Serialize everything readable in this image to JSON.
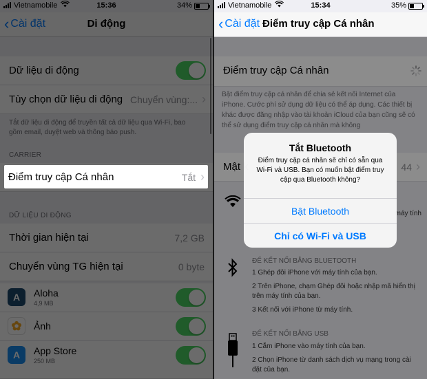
{
  "left": {
    "status": {
      "carrier": "Vietnamobile",
      "time": "15:36",
      "battery": "34%",
      "battery_level": 0.34
    },
    "nav": {
      "back": "Cài đặt",
      "title": "Di động"
    },
    "rows": {
      "mobile_data": "Dữ liệu di động",
      "data_options_label": "Tùy chọn dữ liệu di động",
      "data_options_value": "Chuyển vùng:..."
    },
    "footnote": "Tắt dữ liệu di động để truyền tất cả dữ liệu qua Wi-Fi, bao gồm email, duyệt web và thông báo push.",
    "carrier_header": "CARRIER",
    "hotspot": {
      "label": "Điểm truy cập Cá nhân",
      "value": "Tắt"
    },
    "usage_header": "DỮ LIỆU DI ĐỘNG",
    "current_period": {
      "label": "Thời gian hiện tại",
      "value": "7,2 GB"
    },
    "roaming": {
      "label": "Chuyển vùng TG hiện tại",
      "value": "0 byte"
    },
    "apps": [
      {
        "name": "Aloha",
        "size": "4,9 MB",
        "icon": "aloha-icon",
        "color": "#1e4b6e"
      },
      {
        "name": "Ảnh",
        "size": "",
        "icon": "photos-icon",
        "color": "#ffffff"
      },
      {
        "name": "App Store",
        "size": "250 MB",
        "icon": "app-store-icon",
        "color": "#1a8cf0"
      }
    ]
  },
  "right": {
    "status": {
      "carrier": "Vietnamobile",
      "time": "15:34",
      "battery": "35%",
      "battery_level": 0.35
    },
    "nav": {
      "back": "Cài đặt",
      "title": "Điểm truy cập Cá nhân"
    },
    "hotspot_label": "Điểm truy cập Cá nhân",
    "description": "Bật điểm truy cập cá nhân để chia sẻ kết nối Internet của iPhone. Cước phí sử dụng dữ liệu có thể áp dụng. Các thiết bị khác được đăng nhập vào tài khoản iCloud của bạn cũng sẽ có thể sử dụng điểm truy cập cá nhân mà không",
    "password_label": "Mật k",
    "password_value_partial": "44",
    "wifi_partial": "máy tính",
    "bluetooth_header": "ĐỂ KẾT NỐI BẰNG BLUETOOTH",
    "bluetooth_steps": [
      "1 Ghép đôi iPhone với máy tính của bạn.",
      "2 Trên iPhone, chạm Ghép đôi hoặc nhập mã hiển thị trên máy tính của bạn.",
      "3 Kết nối với iPhone từ máy tính."
    ],
    "usb_header": "ĐỂ KẾT NỐI BẰNG USB",
    "usb_steps": [
      "1 Cắm iPhone vào máy tính của bạn.",
      "2 Chọn iPhone từ danh sách dịch vụ mạng trong cài đặt của bạn."
    ],
    "alert": {
      "title": "Tắt Bluetooth",
      "message": "Điểm truy cập cá nhân sẽ chỉ có sẵn qua Wi-Fi và USB. Bạn có muốn bật điểm truy cập qua Bluetooth không?",
      "button_1": "Bật Bluetooth",
      "button_2": "Chỉ có Wi-Fi và USB"
    }
  },
  "colors": {
    "accent": "#007aff",
    "toggle_on": "#4cd964"
  }
}
